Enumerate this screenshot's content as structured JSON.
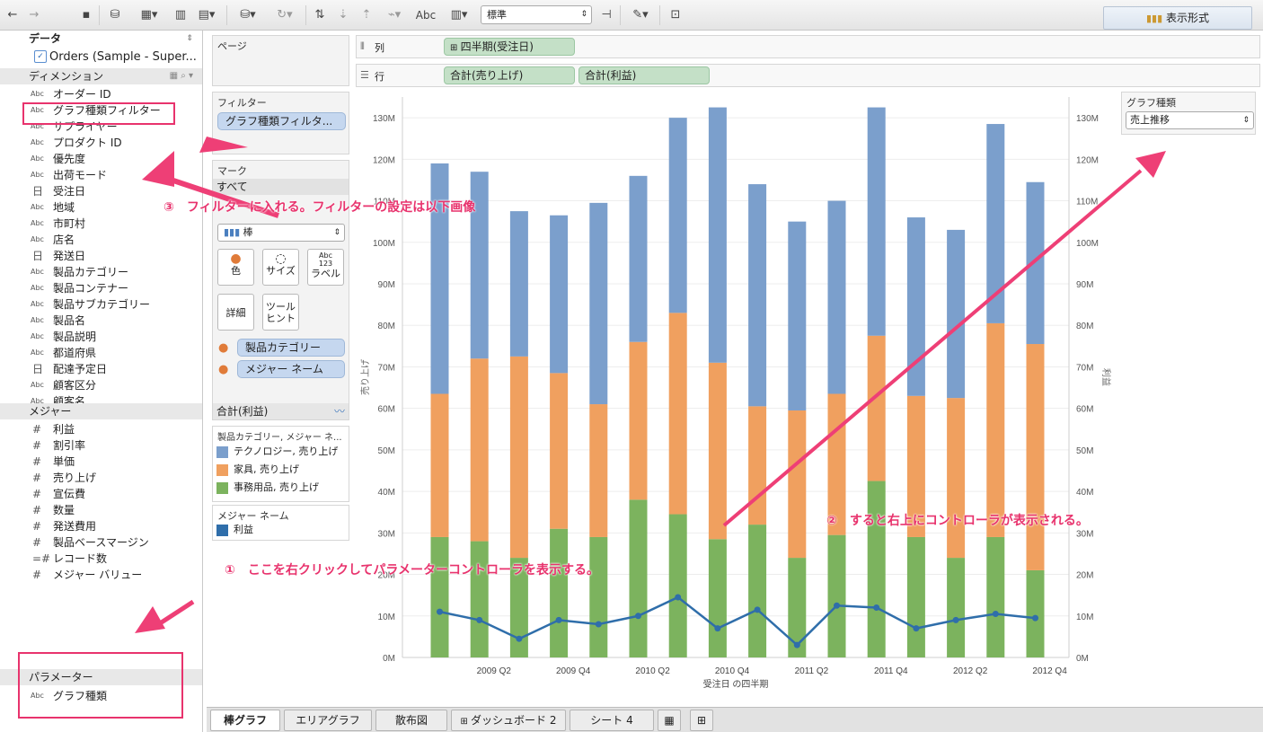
{
  "toolbar": {
    "view_select": "標準",
    "text_icon": "Abc",
    "showme_label": "表示形式"
  },
  "datapane": {
    "data_header": "データ",
    "datasource": "Orders (Sample - Super...",
    "dimensions_header": "ディメンション",
    "dimensions": [
      {
        "icon": "Abc",
        "label": "オーダー ID"
      },
      {
        "icon": "Abc",
        "label": "グラフ種類フィルター"
      },
      {
        "icon": "Abc",
        "label": "サプライヤー"
      },
      {
        "icon": "Abc",
        "label": "プロダクト ID"
      },
      {
        "icon": "Abc",
        "label": "優先度"
      },
      {
        "icon": "Abc",
        "label": "出荷モード"
      },
      {
        "icon": "日",
        "label": "受注日"
      },
      {
        "icon": "Abc",
        "label": "地域"
      },
      {
        "icon": "Abc",
        "label": "市町村"
      },
      {
        "icon": "Abc",
        "label": "店名"
      },
      {
        "icon": "日",
        "label": "発送日"
      },
      {
        "icon": "Abc",
        "label": "製品カテゴリー"
      },
      {
        "icon": "Abc",
        "label": "製品コンテナー"
      },
      {
        "icon": "Abc",
        "label": "製品サブカテゴリー"
      },
      {
        "icon": "Abc",
        "label": "製品名"
      },
      {
        "icon": "Abc",
        "label": "製品説明"
      },
      {
        "icon": "Abc",
        "label": "都道府県"
      },
      {
        "icon": "日",
        "label": "配達予定日"
      },
      {
        "icon": "Abc",
        "label": "顧客区分"
      },
      {
        "icon": "Abc",
        "label": "顧客名"
      }
    ],
    "measures_header": "メジャー",
    "measures": [
      {
        "icon": "#",
        "label": "利益"
      },
      {
        "icon": "#",
        "label": "割引率"
      },
      {
        "icon": "#",
        "label": "単価"
      },
      {
        "icon": "#",
        "label": "売り上げ"
      },
      {
        "icon": "#",
        "label": "宣伝費"
      },
      {
        "icon": "#",
        "label": "数量"
      },
      {
        "icon": "#",
        "label": "発送費用"
      },
      {
        "icon": "#",
        "label": "製品ベースマージン"
      },
      {
        "icon": "=#",
        "label": "レコード数"
      },
      {
        "icon": "#",
        "label": "メジャー バリュー"
      }
    ],
    "parameters_header": "パラメーター",
    "parameters": [
      {
        "icon": "Abc",
        "label": "グラフ種類"
      }
    ]
  },
  "shelves": {
    "pages_title": "ページ",
    "filters_title": "フィルター",
    "filter_pill": "グラフ種類フィルタ...",
    "columns_label": "列",
    "rows_label": "行",
    "columns_pill": "四半期(受注日)",
    "rows_pills": [
      "合計(売り上げ)",
      "合計(利益)"
    ]
  },
  "marks": {
    "title": "マーク",
    "all_label": "すべて",
    "hidden_label": "合計(売り上げ)",
    "type_select": "棒",
    "buttons": [
      "色",
      "サイズ",
      "ラベル",
      "詳細",
      "ツール\nヒント"
    ],
    "label_icon": "Abc\n123",
    "color_pills": [
      "製品カテゴリー",
      "メジャー ネーム"
    ],
    "profit_row": "合計(利益)"
  },
  "legends": {
    "color_title": "製品カテゴリー, メジャー ネ...",
    "color_items": [
      {
        "label": "テクノロジー, 売り上げ",
        "color": "#7b9fcc"
      },
      {
        "label": "家具, 売り上げ",
        "color": "#f0a05f"
      },
      {
        "label": "事務用品, 売り上げ",
        "color": "#7cb35e"
      }
    ],
    "measure_title": "メジャー ネーム",
    "measure_items": [
      {
        "label": "利益",
        "color": "#2f6eaa"
      }
    ]
  },
  "parameter_control": {
    "title": "グラフ種類",
    "value": "売上推移"
  },
  "tabs": [
    "棒グラフ",
    "エリアグラフ",
    "散布図",
    "ダッシュボード 2",
    "シート 4"
  ],
  "annotations": [
    "③　フィルターに入れる。フィルターの設定は以下画像",
    "①　ここを右クリックしてパラメーターコントローラを表示する。",
    "②　すると右上にコントローラが表示される。"
  ],
  "chart_data": {
    "type": "bar",
    "x_title": "受注日 の四半期",
    "y_title_left": "売り上げ",
    "y_title_right": "利益",
    "x_tick_labels": [
      "2009 Q2",
      "2009 Q4",
      "2010 Q2",
      "2010 Q4",
      "2011 Q2",
      "2011 Q4",
      "2012 Q2",
      "2012 Q4"
    ],
    "y_ticks_left": [
      "0M",
      "10M",
      "20M",
      "30M",
      "40M",
      "50M",
      "60M",
      "70M",
      "80M",
      "90M",
      "100M",
      "110M",
      "120M",
      "130M"
    ],
    "y_ticks_right": [
      "0M",
      "10M",
      "20M",
      "30M",
      "40M",
      "50M",
      "60M",
      "70M",
      "80M",
      "90M",
      "100M",
      "110M",
      "120M",
      "130M"
    ],
    "ylim": [
      0,
      135
    ],
    "categories": [
      "2009 Q1",
      "2009 Q2",
      "2009 Q3",
      "2009 Q4",
      "2010 Q1",
      "2010 Q2",
      "2010 Q3",
      "2010 Q4",
      "2011 Q1",
      "2011 Q2",
      "2011 Q3",
      "2011 Q4",
      "2012 Q1",
      "2012 Q2",
      "2012 Q3",
      "2012 Q4"
    ],
    "series": [
      {
        "name": "事務用品, 売り上げ",
        "color": "#7cb35e",
        "values": [
          29,
          28,
          24,
          31,
          29,
          38,
          34.5,
          28.5,
          32,
          24,
          29.5,
          42.5,
          29,
          24,
          29,
          21
        ]
      },
      {
        "name": "家具, 売り上げ",
        "color": "#f0a05f",
        "values": [
          34.5,
          44,
          48.5,
          37.5,
          32,
          38,
          48.5,
          42.5,
          28.5,
          35.5,
          34,
          35,
          34,
          38.5,
          51.5,
          54.5
        ]
      },
      {
        "name": "テクノロジー, 売り上げ",
        "color": "#7b9fcc",
        "values": [
          55.5,
          45,
          35,
          38,
          48.5,
          40,
          47,
          61.5,
          53.5,
          45.5,
          46.5,
          55,
          43,
          40.5,
          48,
          39
        ]
      },
      {
        "name": "利益",
        "color": "#2f6eaa",
        "type": "line",
        "values": [
          11,
          9,
          4.5,
          9,
          8,
          10,
          14.5,
          7,
          11.5,
          3,
          12.5,
          12,
          7,
          9,
          10.5,
          9.5
        ]
      }
    ]
  }
}
